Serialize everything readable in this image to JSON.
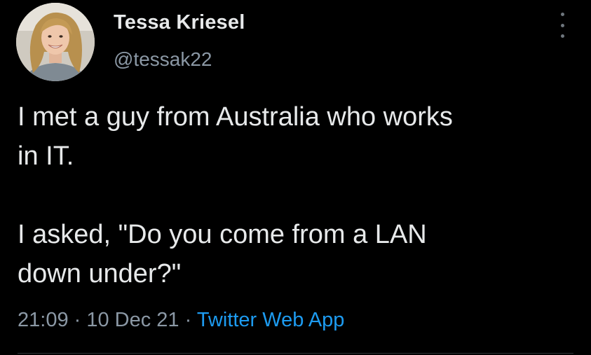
{
  "author": {
    "name": "Tessa Kriesel",
    "handle": "@tessak22"
  },
  "tweet": {
    "text": "I met a guy from Australia who works\nin IT.\n\nI asked, \"Do you come from a LAN\ndown under?\""
  },
  "meta": {
    "time": "21:09",
    "separator_1": " · ",
    "date": "10 Dec 21",
    "separator_2": " · ",
    "source": "Twitter Web App"
  },
  "icons": {
    "more": "more-vertical-icon"
  },
  "colors": {
    "background": "#000000",
    "text": "#e7e9ea",
    "secondary": "#8b98a5",
    "link": "#1d9bf0"
  }
}
